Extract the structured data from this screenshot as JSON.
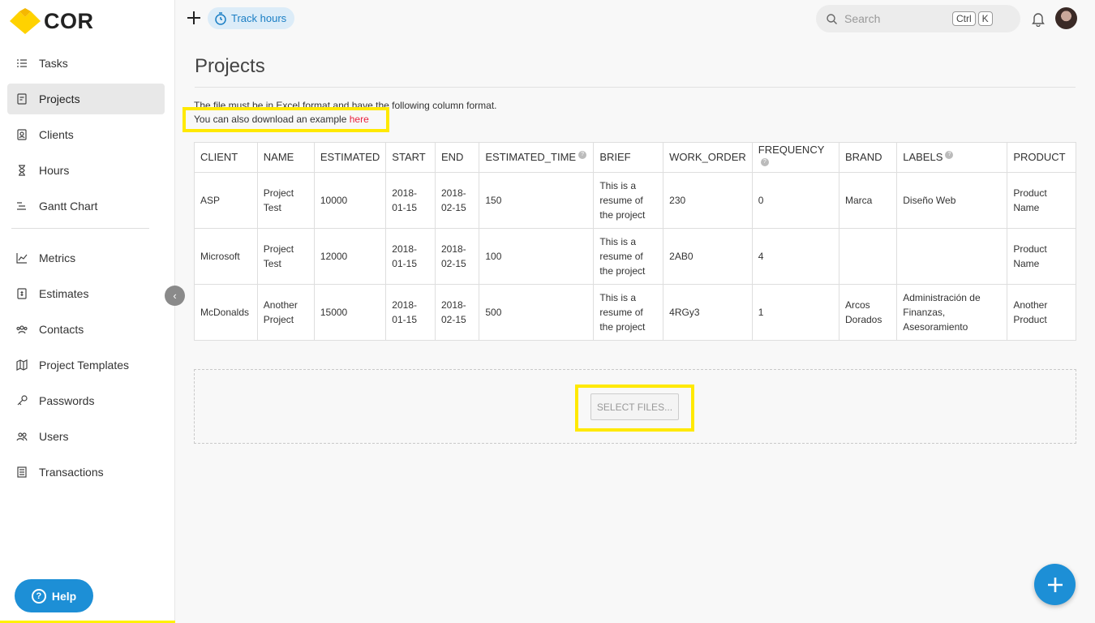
{
  "app": {
    "logo_text": "COR"
  },
  "sidebar": {
    "items": [
      {
        "label": "Tasks",
        "icon": "tasks-icon"
      },
      {
        "label": "Projects",
        "icon": "projects-icon",
        "active": true
      },
      {
        "label": "Clients",
        "icon": "clients-icon"
      },
      {
        "label": "Hours",
        "icon": "hourglass-icon"
      },
      {
        "label": "Gantt Chart",
        "icon": "gantt-icon"
      },
      {
        "label": "Metrics",
        "icon": "metrics-icon"
      },
      {
        "label": "Estimates",
        "icon": "estimates-icon"
      },
      {
        "label": "Contacts",
        "icon": "contacts-icon"
      },
      {
        "label": "Project Templates",
        "icon": "map-icon"
      },
      {
        "label": "Passwords",
        "icon": "key-icon"
      },
      {
        "label": "Users",
        "icon": "users-icon"
      },
      {
        "label": "Transactions",
        "icon": "transactions-icon"
      }
    ],
    "help_label": "Help"
  },
  "topbar": {
    "track_hours_label": "Track hours",
    "search_placeholder": "Search",
    "shortcut_keys": [
      "Ctrl",
      "K"
    ]
  },
  "main": {
    "title": "Projects",
    "instructions": "The file must be in Excel format and have the following column format.",
    "download_text": "You can also download an example",
    "download_link": "here",
    "table": {
      "headers": [
        "CLIENT",
        "NAME",
        "ESTIMATED",
        "START",
        "END",
        "ESTIMATED_TIME",
        "BRIEF",
        "WORK_ORDER",
        "FREQUENCY",
        "BRAND",
        "LABELS",
        "PRODUCT"
      ],
      "help_headers": [
        "ESTIMATED_TIME",
        "FREQUENCY",
        "LABELS"
      ],
      "rows": [
        [
          "ASP",
          "Project Test",
          "10000",
          "2018-01-15",
          "2018-02-15",
          "150",
          "This is a resume of the project",
          "230",
          "0",
          "Marca",
          "Diseño Web",
          "Product Name"
        ],
        [
          "Microsoft",
          "Project Test",
          "12000",
          "2018-01-15",
          "2018-02-15",
          "100",
          "This is a resume of the project",
          "2AB0",
          "4",
          "",
          "",
          "Product Name"
        ],
        [
          "McDonalds",
          "Another Project",
          "15000",
          "2018-01-15",
          "2018-02-15",
          "500",
          "This is a resume of the project",
          "4RGy3",
          "1",
          "Arcos Dorados",
          "Administración de Finanzas, Asesoramiento",
          "Another Product"
        ]
      ]
    },
    "select_files_label": "SELECT FILES..."
  },
  "colors": {
    "accent": "#1d8fd6",
    "highlight": "#ffe900",
    "link": "#e8233e",
    "logo_yellow": "#ffd200"
  }
}
